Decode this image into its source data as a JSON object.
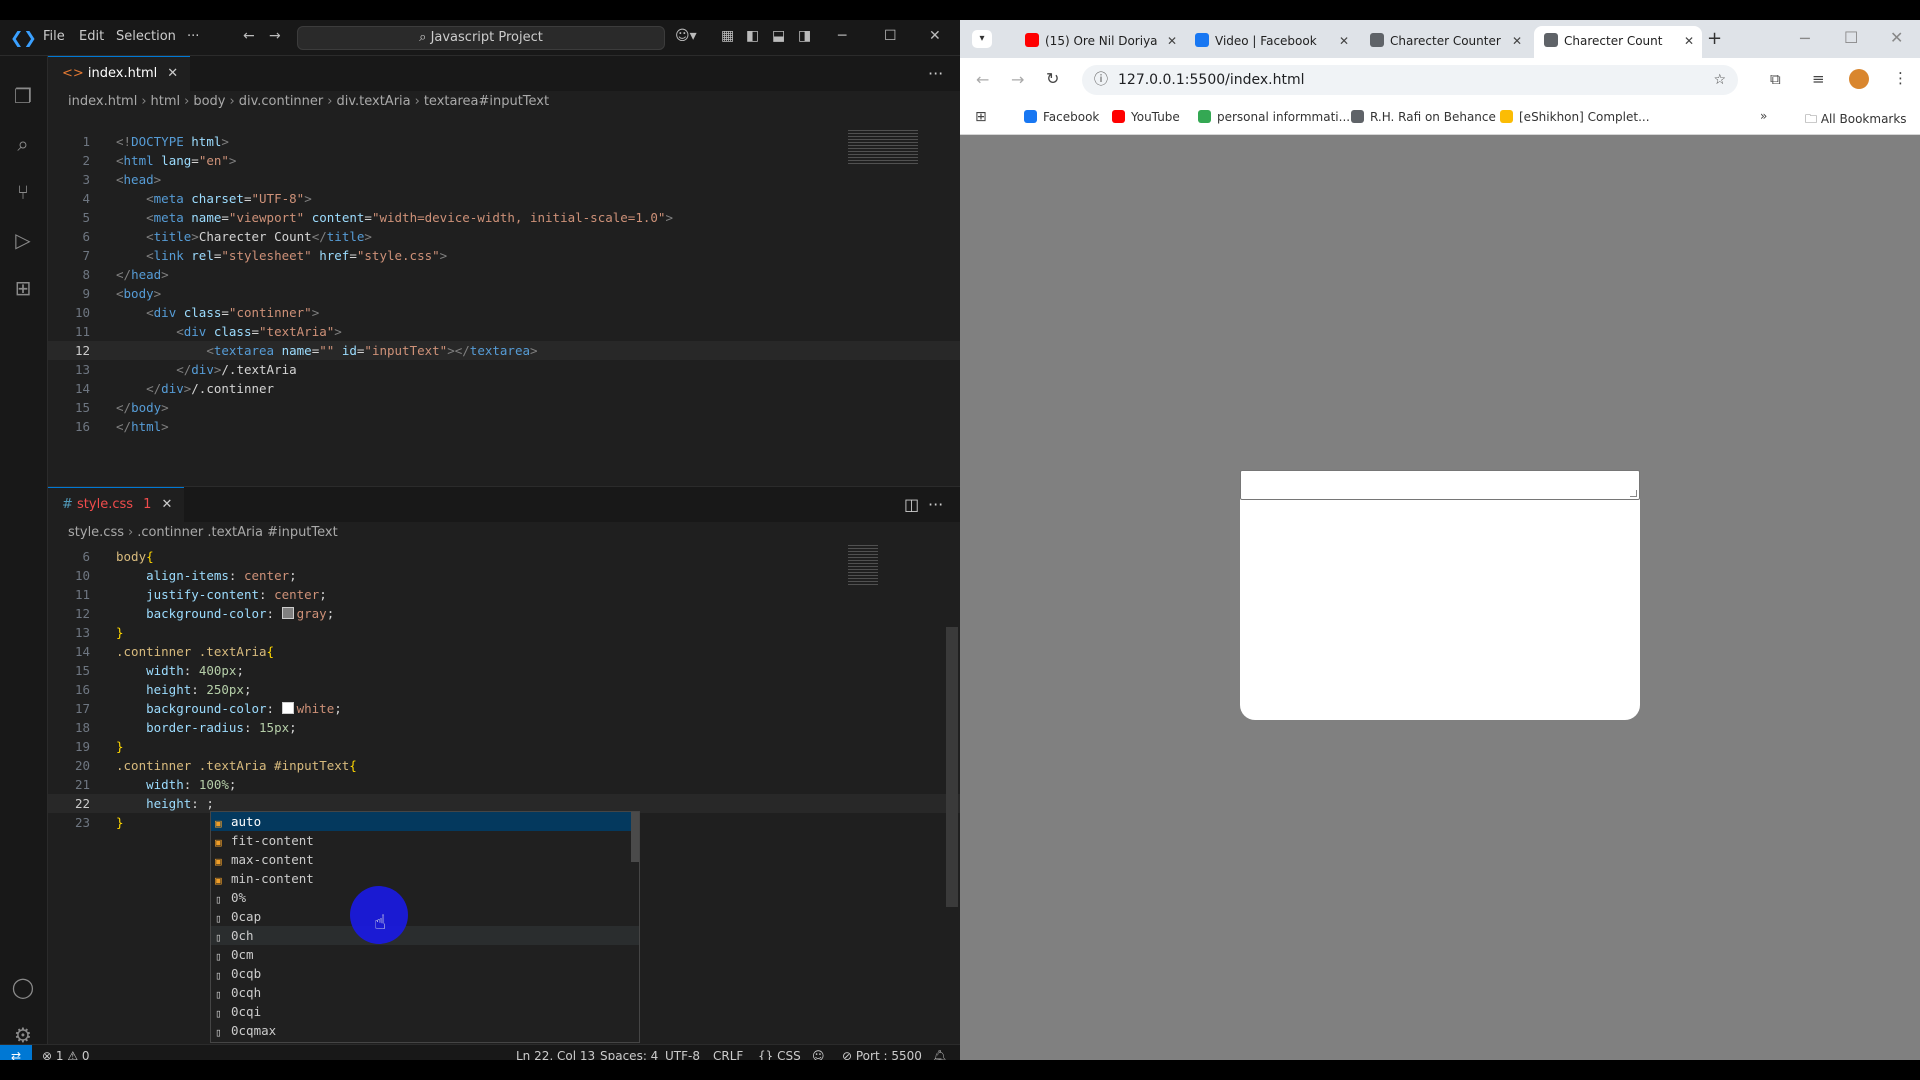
{
  "vscode": {
    "menu": [
      "File",
      "Edit",
      "Selection",
      "···"
    ],
    "command_center": "Javascript Project",
    "top_group": {
      "tab": "index.html",
      "breadcrumb": [
        "index.html",
        "html",
        "body",
        "div.continner",
        "div.textAria",
        "textarea#inputText"
      ],
      "lines": [
        {
          "n": "1",
          "segs": [
            [
              "t-pun",
              "<!"
            ],
            [
              "t-tag",
              "DOCTYPE"
            ],
            [
              "t-txt",
              " "
            ],
            [
              "t-attr",
              "html"
            ],
            [
              "t-pun",
              ">"
            ]
          ]
        },
        {
          "n": "2",
          "segs": [
            [
              "t-pun",
              "<"
            ],
            [
              "t-tag",
              "html"
            ],
            [
              "t-txt",
              " "
            ],
            [
              "t-attr",
              "lang"
            ],
            [
              "t-txt",
              "="
            ],
            [
              "t-str",
              "\"en\""
            ],
            [
              "t-pun",
              ">"
            ]
          ]
        },
        {
          "n": "3",
          "segs": [
            [
              "t-pun",
              "<"
            ],
            [
              "t-tag",
              "head"
            ],
            [
              "t-pun",
              ">"
            ]
          ]
        },
        {
          "n": "4",
          "segs": [
            [
              "t-txt",
              "    "
            ],
            [
              "t-pun",
              "<"
            ],
            [
              "t-tag",
              "meta"
            ],
            [
              "t-txt",
              " "
            ],
            [
              "t-attr",
              "charset"
            ],
            [
              "t-txt",
              "="
            ],
            [
              "t-str",
              "\"UTF-8\""
            ],
            [
              "t-pun",
              ">"
            ]
          ]
        },
        {
          "n": "5",
          "segs": [
            [
              "t-txt",
              "    "
            ],
            [
              "t-pun",
              "<"
            ],
            [
              "t-tag",
              "meta"
            ],
            [
              "t-txt",
              " "
            ],
            [
              "t-attr",
              "name"
            ],
            [
              "t-txt",
              "="
            ],
            [
              "t-str",
              "\"viewport\""
            ],
            [
              "t-txt",
              " "
            ],
            [
              "t-attr",
              "content"
            ],
            [
              "t-txt",
              "="
            ],
            [
              "t-str",
              "\"width=device-width, initial-scale=1.0\""
            ],
            [
              "t-pun",
              ">"
            ]
          ]
        },
        {
          "n": "6",
          "segs": [
            [
              "t-txt",
              "    "
            ],
            [
              "t-pun",
              "<"
            ],
            [
              "t-tag",
              "title"
            ],
            [
              "t-pun",
              ">"
            ],
            [
              "t-txt",
              "Charecter Count"
            ],
            [
              "t-pun",
              "</"
            ],
            [
              "t-tag",
              "title"
            ],
            [
              "t-pun",
              ">"
            ]
          ]
        },
        {
          "n": "7",
          "segs": [
            [
              "t-txt",
              "    "
            ],
            [
              "t-pun",
              "<"
            ],
            [
              "t-tag",
              "link"
            ],
            [
              "t-txt",
              " "
            ],
            [
              "t-attr",
              "rel"
            ],
            [
              "t-txt",
              "="
            ],
            [
              "t-str",
              "\"stylesheet\""
            ],
            [
              "t-txt",
              " "
            ],
            [
              "t-attr",
              "href"
            ],
            [
              "t-txt",
              "="
            ],
            [
              "t-str",
              "\"style.css\""
            ],
            [
              "t-pun",
              ">"
            ]
          ]
        },
        {
          "n": "8",
          "segs": [
            [
              "t-pun",
              "</"
            ],
            [
              "t-tag",
              "head"
            ],
            [
              "t-pun",
              ">"
            ]
          ]
        },
        {
          "n": "9",
          "segs": [
            [
              "t-pun",
              "<"
            ],
            [
              "t-tag",
              "body"
            ],
            [
              "t-pun",
              ">"
            ]
          ]
        },
        {
          "n": "10",
          "segs": [
            [
              "t-txt",
              "    "
            ],
            [
              "t-pun",
              "<"
            ],
            [
              "t-tag",
              "div"
            ],
            [
              "t-txt",
              " "
            ],
            [
              "t-attr",
              "class"
            ],
            [
              "t-txt",
              "="
            ],
            [
              "t-str",
              "\"continner\""
            ],
            [
              "t-pun",
              ">"
            ]
          ]
        },
        {
          "n": "11",
          "segs": [
            [
              "t-txt",
              "        "
            ],
            [
              "t-pun",
              "<"
            ],
            [
              "t-tag",
              "div"
            ],
            [
              "t-txt",
              " "
            ],
            [
              "t-attr",
              "class"
            ],
            [
              "t-txt",
              "="
            ],
            [
              "t-str",
              "\"textAria\""
            ],
            [
              "t-pun",
              ">"
            ]
          ]
        },
        {
          "n": "12",
          "cur": true,
          "segs": [
            [
              "t-txt",
              "            "
            ],
            [
              "t-pun",
              "<"
            ],
            [
              "t-tag",
              "textarea"
            ],
            [
              "t-txt",
              " "
            ],
            [
              "t-attr",
              "name"
            ],
            [
              "t-txt",
              "="
            ],
            [
              "t-str",
              "\"\""
            ],
            [
              "t-txt",
              " "
            ],
            [
              "t-attr",
              "id"
            ],
            [
              "t-txt",
              "="
            ],
            [
              "t-str",
              "\"inputText\""
            ],
            [
              "t-pun",
              "></"
            ],
            [
              "t-tag",
              "textarea"
            ],
            [
              "t-pun",
              ">"
            ]
          ]
        },
        {
          "n": "13",
          "segs": [
            [
              "t-txt",
              "        "
            ],
            [
              "t-pun",
              "</"
            ],
            [
              "t-tag",
              "div"
            ],
            [
              "t-pun",
              ">"
            ],
            [
              "t-txt",
              "/.textAria"
            ]
          ]
        },
        {
          "n": "14",
          "segs": [
            [
              "t-txt",
              "    "
            ],
            [
              "t-pun",
              "</"
            ],
            [
              "t-tag",
              "div"
            ],
            [
              "t-pun",
              ">"
            ],
            [
              "t-txt",
              "/.continner"
            ]
          ]
        },
        {
          "n": "15",
          "segs": [
            [
              "t-pun",
              "</"
            ],
            [
              "t-tag",
              "body"
            ],
            [
              "t-pun",
              ">"
            ]
          ]
        },
        {
          "n": "16",
          "segs": [
            [
              "t-pun",
              "</"
            ],
            [
              "t-tag",
              "html"
            ],
            [
              "t-pun",
              ">"
            ]
          ]
        }
      ]
    },
    "bottom_group": {
      "tab": "style.css",
      "tab_badge": "1",
      "breadcrumb": [
        "style.css",
        ".continner .textAria #inputText"
      ],
      "lines": [
        {
          "n": "6",
          "segs": [
            [
              "t-sel",
              "body"
            ],
            [
              "t-brace",
              "{"
            ]
          ]
        },
        {
          "n": "10",
          "segs": [
            [
              "t-txt",
              "    "
            ],
            [
              "t-prop",
              "align-items"
            ],
            [
              "t-txt",
              ": "
            ],
            [
              "t-val",
              "center"
            ],
            [
              "t-txt",
              ";"
            ]
          ]
        },
        {
          "n": "11",
          "segs": [
            [
              "t-txt",
              "    "
            ],
            [
              "t-prop",
              "justify-content"
            ],
            [
              "t-txt",
              ": "
            ],
            [
              "t-val",
              "center"
            ],
            [
              "t-txt",
              ";"
            ]
          ]
        },
        {
          "n": "12",
          "segs": [
            [
              "t-txt",
              "    "
            ],
            [
              "t-prop",
              "background-color"
            ],
            [
              "t-txt",
              ": "
            ],
            [
              "sw",
              "#808080"
            ],
            [
              "t-val",
              "gray"
            ],
            [
              "t-txt",
              ";"
            ]
          ]
        },
        {
          "n": "13",
          "segs": [
            [
              "t-brace",
              "}"
            ]
          ]
        },
        {
          "n": "14",
          "segs": [
            [
              "t-sel",
              ".continner .textAria"
            ],
            [
              "t-brace",
              "{"
            ]
          ]
        },
        {
          "n": "15",
          "segs": [
            [
              "t-txt",
              "    "
            ],
            [
              "t-prop",
              "width"
            ],
            [
              "t-txt",
              ": "
            ],
            [
              "t-num",
              "400px"
            ],
            [
              "t-txt",
              ";"
            ]
          ]
        },
        {
          "n": "16",
          "segs": [
            [
              "t-txt",
              "    "
            ],
            [
              "t-prop",
              "height"
            ],
            [
              "t-txt",
              ": "
            ],
            [
              "t-num",
              "250px"
            ],
            [
              "t-txt",
              ";"
            ]
          ]
        },
        {
          "n": "17",
          "segs": [
            [
              "t-txt",
              "    "
            ],
            [
              "t-prop",
              "background-color"
            ],
            [
              "t-txt",
              ": "
            ],
            [
              "sw",
              "#ffffff"
            ],
            [
              "t-val",
              "white"
            ],
            [
              "t-txt",
              ";"
            ]
          ]
        },
        {
          "n": "18",
          "segs": [
            [
              "t-txt",
              "    "
            ],
            [
              "t-prop",
              "border-radius"
            ],
            [
              "t-txt",
              ": "
            ],
            [
              "t-num",
              "15px"
            ],
            [
              "t-txt",
              ";"
            ]
          ]
        },
        {
          "n": "19",
          "segs": [
            [
              "t-brace",
              "}"
            ]
          ]
        },
        {
          "n": "20",
          "segs": [
            [
              "t-sel",
              ".continner .textAria #inputText"
            ],
            [
              "t-brace",
              "{"
            ]
          ]
        },
        {
          "n": "21",
          "segs": [
            [
              "t-txt",
              "    "
            ],
            [
              "t-prop",
              "width"
            ],
            [
              "t-txt",
              ": "
            ],
            [
              "t-num",
              "100%"
            ],
            [
              "t-txt",
              ";"
            ]
          ]
        },
        {
          "n": "22",
          "cur": true,
          "segs": [
            [
              "t-txt",
              "    "
            ],
            [
              "t-prop",
              "height"
            ],
            [
              "t-txt",
              ": ;"
            ]
          ]
        },
        {
          "n": "23",
          "segs": [
            [
              "t-brace",
              "}"
            ]
          ]
        }
      ]
    },
    "suggestions": [
      {
        "label": "auto",
        "kind": "value"
      },
      {
        "label": "fit-content",
        "kind": "value"
      },
      {
        "label": "max-content",
        "kind": "value"
      },
      {
        "label": "min-content",
        "kind": "value"
      },
      {
        "label": "0%",
        "kind": "unit"
      },
      {
        "label": "0cap",
        "kind": "unit"
      },
      {
        "label": "0ch",
        "kind": "unit"
      },
      {
        "label": "0cm",
        "kind": "unit"
      },
      {
        "label": "0cqb",
        "kind": "unit"
      },
      {
        "label": "0cqh",
        "kind": "unit"
      },
      {
        "label": "0cqi",
        "kind": "unit"
      },
      {
        "label": "0cqmax",
        "kind": "unit"
      }
    ],
    "status": {
      "problems": "⊗ 1 ⚠ 0",
      "position": "Ln 22, Col 13",
      "spaces": "Spaces: 4",
      "encoding": "UTF-8",
      "eol": "CRLF",
      "language": "{} CSS",
      "port": "Port : 5500"
    }
  },
  "chrome": {
    "tabs": [
      {
        "title": "(15) Ore Nil Doriya",
        "fav": "#ff0000",
        "active": false
      },
      {
        "title": "Video | Facebook",
        "fav": "#1877f2",
        "active": false
      },
      {
        "title": "Charecter Counter",
        "fav": "#5f6368",
        "active": false
      },
      {
        "title": "Charecter Count",
        "fav": "#5f6368",
        "active": true
      }
    ],
    "url": "127.0.0.1:5500/index.html",
    "bookmarks": [
      {
        "label": "Facebook",
        "color": "#1877f2"
      },
      {
        "label": "YouTube",
        "color": "#ff0000"
      },
      {
        "label": "personal informmati...",
        "color": "#34a853"
      },
      {
        "label": "R.H. Rafi on Behance",
        "color": "#5f6368"
      },
      {
        "label": "[eShikhon] Complet...",
        "color": "#fbbc04"
      }
    ],
    "all_bookmarks": "All Bookmarks"
  }
}
